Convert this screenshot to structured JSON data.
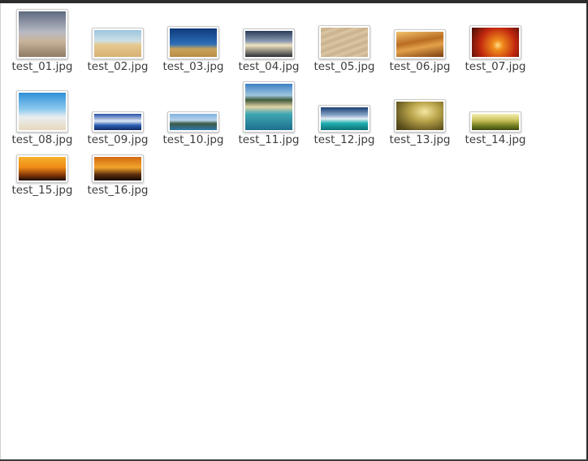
{
  "files": [
    {
      "name": "test_01.jpg",
      "icon": "landscape-thumbnail-icon"
    },
    {
      "name": "test_02.jpg",
      "icon": "landscape-thumbnail-icon"
    },
    {
      "name": "test_03.jpg",
      "icon": "landscape-thumbnail-icon"
    },
    {
      "name": "test_04.jpg",
      "icon": "landscape-thumbnail-icon"
    },
    {
      "name": "test_05.jpg",
      "icon": "landscape-thumbnail-icon"
    },
    {
      "name": "test_06.jpg",
      "icon": "landscape-thumbnail-icon"
    },
    {
      "name": "test_07.jpg",
      "icon": "landscape-thumbnail-icon"
    },
    {
      "name": "test_08.jpg",
      "icon": "landscape-thumbnail-icon"
    },
    {
      "name": "test_09.jpg",
      "icon": "landscape-thumbnail-icon"
    },
    {
      "name": "test_10.jpg",
      "icon": "landscape-thumbnail-icon"
    },
    {
      "name": "test_11.jpg",
      "icon": "landscape-thumbnail-icon"
    },
    {
      "name": "test_12.jpg",
      "icon": "landscape-thumbnail-icon"
    },
    {
      "name": "test_13.jpg",
      "icon": "landscape-thumbnail-icon"
    },
    {
      "name": "test_14.jpg",
      "icon": "landscape-thumbnail-icon"
    },
    {
      "name": "test_15.jpg",
      "icon": "landscape-thumbnail-icon"
    },
    {
      "name": "test_16.jpg",
      "icon": "landscape-thumbnail-icon"
    }
  ]
}
